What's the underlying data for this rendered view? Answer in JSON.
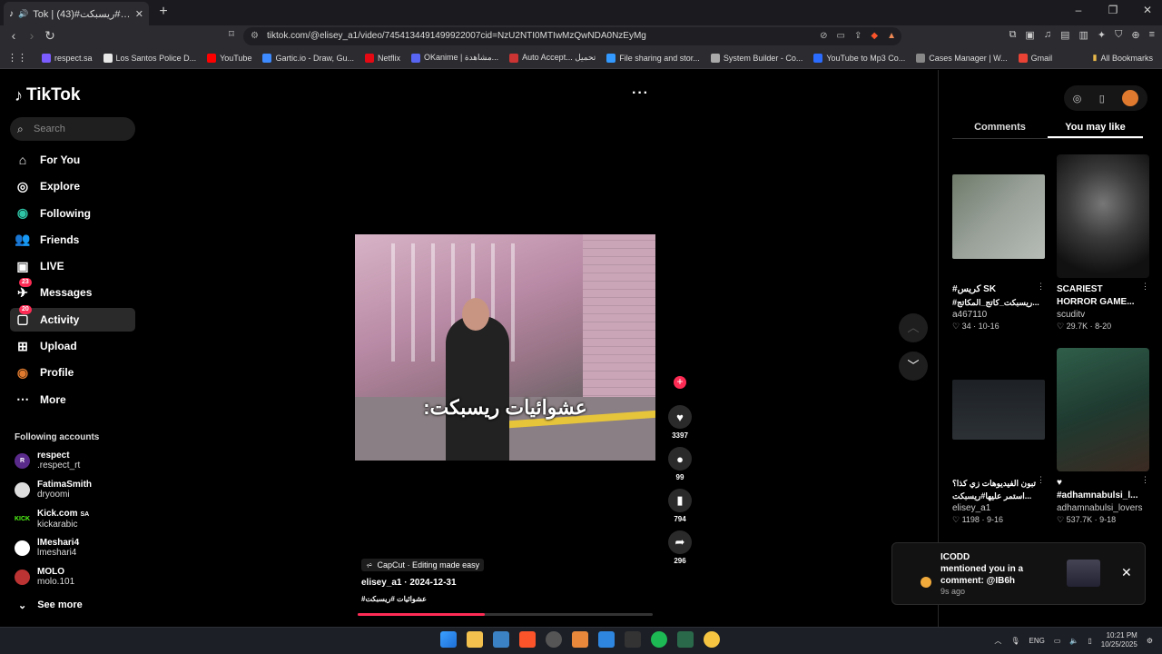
{
  "browser": {
    "tab_title": "Tok | عشوائيات#ريسبكت#(43)",
    "url": "tiktok.com/@elisey_a1/video/7454134491499922007cid=NzU2NTI0MTIwMzQwNDA0NzEyMg",
    "bookmarks": [
      "respect.sa",
      "Los Santos Police D...",
      "YouTube",
      "Gartic.io - Draw, Gu...",
      "Netflix",
      "OKanime | مشاهدة...",
      "Auto Accept... تحميل",
      "File sharing and stor...",
      "System Builder - Co...",
      "YouTube to Mp3 Co...",
      "Cases Manager | W...",
      "Gmail"
    ],
    "all_bookmarks": "All Bookmarks"
  },
  "brand": {
    "name": "TikTok"
  },
  "search": {
    "placeholder": "Search"
  },
  "nav": [
    {
      "label": "For You",
      "icon": "home-icon"
    },
    {
      "label": "Explore",
      "icon": "compass-icon"
    },
    {
      "label": "Following",
      "icon": "following-icon"
    },
    {
      "label": "Friends",
      "icon": "friends-icon"
    },
    {
      "label": "LIVE",
      "icon": "live-icon"
    },
    {
      "label": "Messages",
      "icon": "messages-icon",
      "badge": "23"
    },
    {
      "label": "Activity",
      "icon": "activity-icon",
      "badge": "20"
    },
    {
      "label": "Upload",
      "icon": "upload-icon"
    },
    {
      "label": "Profile",
      "icon": "profile-icon"
    },
    {
      "label": "More",
      "icon": "more-icon"
    }
  ],
  "following_accounts": {
    "title": "Following accounts",
    "items": [
      {
        "name": "respect",
        "handle": ".respect_rt"
      },
      {
        "name": "FatimaSmith",
        "handle": "dryoomi"
      },
      {
        "name": "Kick.com",
        "tag": "SA",
        "handle": "kickarabic"
      },
      {
        "name": "lMeshari4",
        "handle": "lmeshari4"
      },
      {
        "name": "MOLO",
        "handle": "molo.101"
      }
    ],
    "see_more": "See more"
  },
  "video": {
    "caption_overlay": "عشوائيات ريسبكت:",
    "effect_label": "CapCut · Editing made easy",
    "author_line": "elisey_a1 · 2024-12-31",
    "hashtags": "#عشوائيات #ريسبكت",
    "progress": 0.43,
    "likes": "3397",
    "comments": "99",
    "saves": "794",
    "shares": "296"
  },
  "right_panel": {
    "tabs": [
      "Comments",
      "You may like"
    ],
    "selected_tab": "You may like",
    "cards": [
      {
        "title": "#كريس SK",
        "title2": "#ريسبكت_كاتج_المكاتج...",
        "user": "a467110",
        "likes": "34",
        "date": "10-16"
      },
      {
        "title": "SCARIEST",
        "title2": "HORROR GAME...",
        "user": "scuditv",
        "likes": "29.7K",
        "date": "8-20"
      },
      {
        "title": "تبون الفيديوهات زي كذا؟",
        "title2": "استمر عليها#ريسبكت...",
        "user": "elisey_a1",
        "likes": "1198",
        "date": "9-16"
      },
      {
        "title": "♥",
        "title2": "#adhamnabulsi_l...",
        "user": "adhamnabulsi_lovers",
        "likes": "537.7K",
        "date": "9-18"
      }
    ]
  },
  "toast": {
    "user": "ICODD",
    "message": "mentioned you in a comment: @IB6h",
    "time": "9s ago"
  },
  "taskbar": {
    "lang": "ENG",
    "time": "10:21 PM",
    "date": "10/25/2025"
  }
}
